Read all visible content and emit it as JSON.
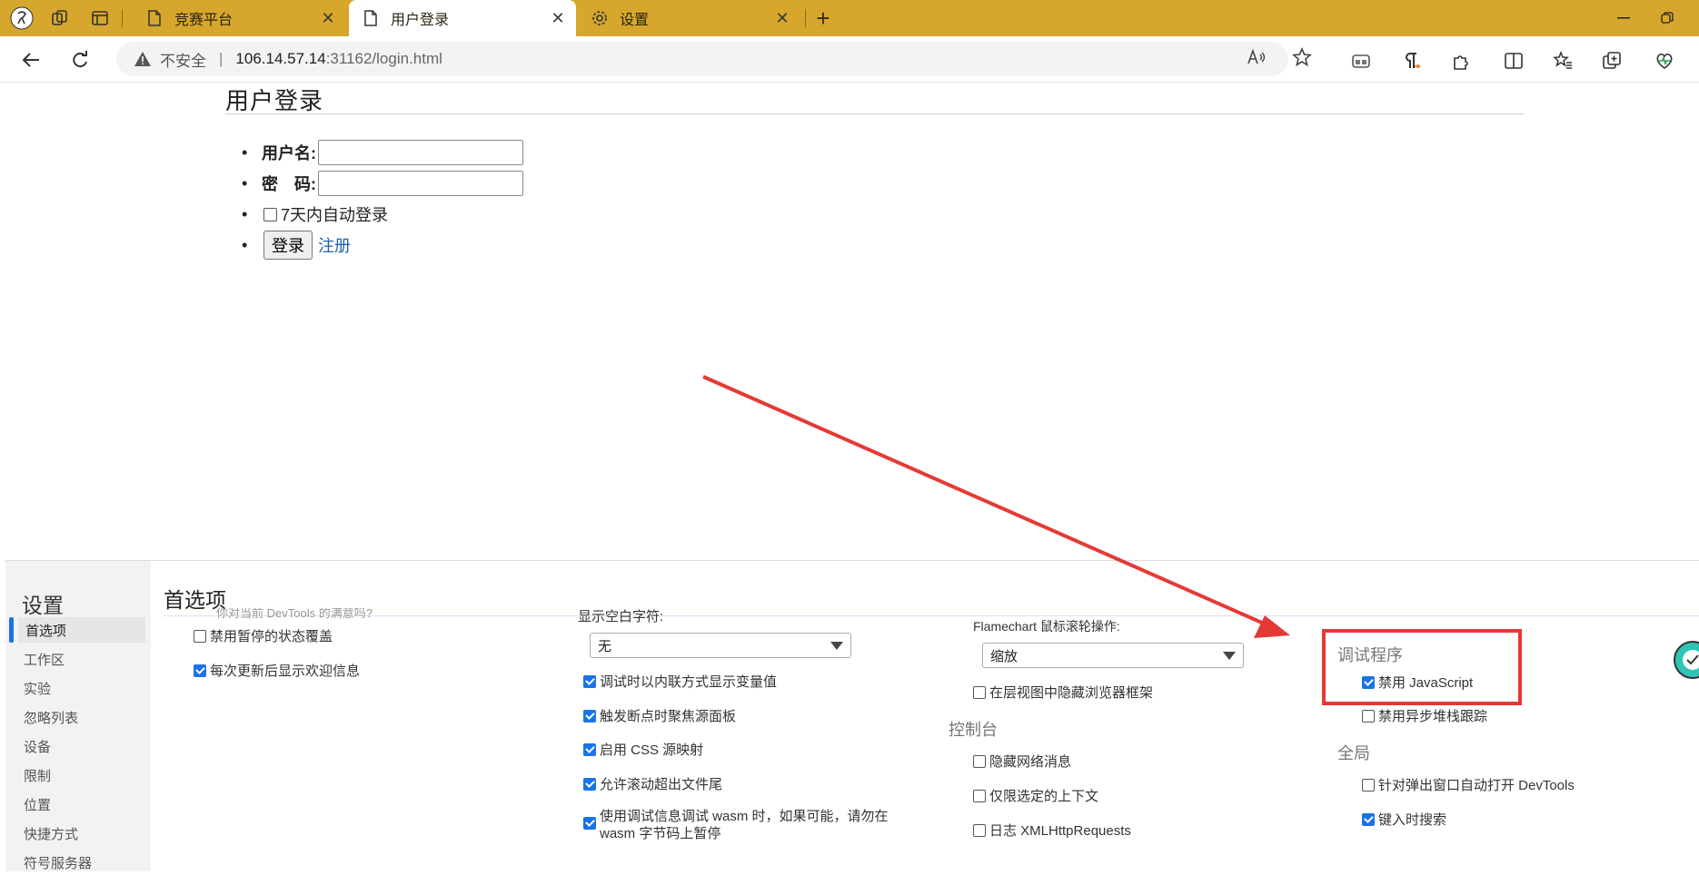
{
  "tabs": [
    {
      "label": "竞赛平台",
      "icon": "page-icon"
    },
    {
      "label": "用户登录",
      "icon": "page-icon"
    },
    {
      "label": "设置",
      "icon": "gear-icon"
    }
  ],
  "address": {
    "warning": "不安全",
    "host": "106.14.57.14",
    "port_path": ":31162/login.html"
  },
  "page": {
    "title": "用户登录",
    "username_label": "用户名:",
    "password_label": "密　码:",
    "remember_label": "7天内自动登录",
    "login_button": "登录",
    "register_link": "注册"
  },
  "devtools": {
    "title": "设置",
    "nav": [
      "首选项",
      "工作区",
      "实验",
      "忽略列表",
      "设备",
      "限制",
      "位置",
      "快捷方式",
      "符号服务器"
    ],
    "selected_nav": "首选项",
    "panel_title": "首选项",
    "col1": {
      "cut_text": "你对当前 DevTools 的满意吗?",
      "options": [
        {
          "label": "禁用暂停的状态覆盖",
          "checked": false
        },
        {
          "label": "每次更新后显示欢迎信息",
          "checked": true
        }
      ]
    },
    "col2": {
      "whitespace_label": "显示空白字符:",
      "whitespace_value": "无",
      "options": [
        {
          "label": "调试时以内联方式显示变量值",
          "checked": true
        },
        {
          "label": "触发断点时聚焦源面板",
          "checked": true
        },
        {
          "label": "启用 CSS 源映射",
          "checked": true
        },
        {
          "label": "允许滚动超出文件尾",
          "checked": true
        },
        {
          "label": "使用调试信息调试 wasm 时，如果可能，请勿在",
          "label2": "wasm 字节码上暂停",
          "checked": true
        }
      ]
    },
    "col3": {
      "flamechart_label": "Flamechart 鼠标滚轮操作:",
      "flamechart_value": "缩放",
      "hide_frames": {
        "label": "在层视图中隐藏浏览器框架",
        "checked": false
      },
      "console_section": "控制台",
      "console_options": [
        {
          "label": "隐藏网络消息",
          "checked": false
        },
        {
          "label": "仅限选定的上下文",
          "checked": false
        },
        {
          "label": "日志 XMLHttpRequests",
          "checked": false
        }
      ]
    },
    "col4": {
      "debugger_section": "调试程序",
      "debugger_options": [
        {
          "label": "禁用 JavaScript",
          "checked": true
        },
        {
          "label": "禁用异步堆栈跟踪",
          "checked": false
        }
      ],
      "global_section": "全局",
      "global_options": [
        {
          "label": "针对弹出窗口自动打开 DevTools",
          "checked": false
        },
        {
          "label": "键入时搜索",
          "checked": true
        }
      ]
    }
  },
  "colors": {
    "tabbar": "#d6a72c",
    "accent": "#1a73e8",
    "annotation_red": "#e53935"
  }
}
